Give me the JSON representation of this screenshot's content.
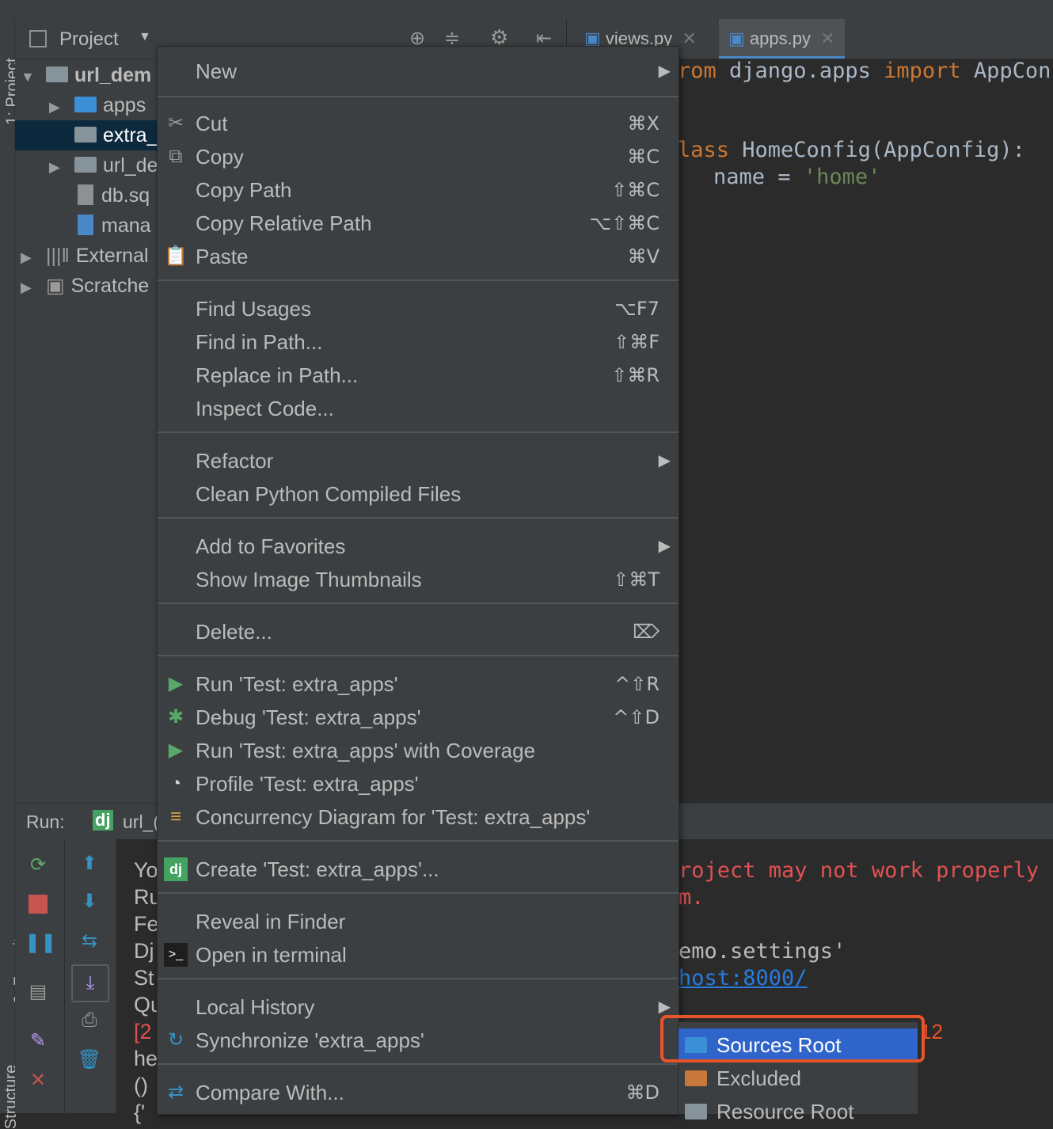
{
  "project_panel": {
    "title": "Project",
    "tree": [
      {
        "label": "url_dem",
        "bold": true,
        "expanded": true
      },
      {
        "label": "apps"
      },
      {
        "label": "extra_"
      },
      {
        "label": "url_de"
      },
      {
        "label": "db.sq"
      },
      {
        "label": "mana"
      },
      {
        "label": "External"
      },
      {
        "label": "Scratche"
      }
    ]
  },
  "editor": {
    "tabs": [
      {
        "label": "views.py"
      },
      {
        "label": "apps.py",
        "active": true
      }
    ],
    "code": {
      "l1_a": "rom ",
      "l1_b": "django.apps ",
      "l1_c": "import ",
      "l1_d": "AppConfi",
      "l2_a": "lass ",
      "l2_b": "HomeConfig(AppConfig):",
      "l3_a": "    name = ",
      "l3_b": "'home'"
    }
  },
  "run_panel": {
    "label": "Run:",
    "config": "url_(",
    "console_prefixes": [
      "Yo",
      "Ru",
      "Fe",
      "Dj",
      "St",
      "Qu",
      "[2",
      "he",
      "()",
      "{'"
    ],
    "console_right": {
      "line1": "roject may not work properly un",
      "line2": "m.",
      "line3": "emo.settings'",
      "link": "host:8000/"
    }
  },
  "context_menu": {
    "items": [
      {
        "label": "New",
        "shortcut": "",
        "submenu": true
      },
      {
        "label": "Cut",
        "shortcut": "⌘X",
        "icon": "scissors-icon"
      },
      {
        "label": "Copy",
        "shortcut": "⌘C",
        "icon": "copy-icon"
      },
      {
        "label": "Copy Path",
        "shortcut": "⇧⌘C"
      },
      {
        "label": "Copy Relative Path",
        "shortcut": "⌥⇧⌘C"
      },
      {
        "label": "Paste",
        "shortcut": "⌘V",
        "icon": "paste-icon"
      },
      {
        "label": "Find Usages",
        "shortcut": "⌥F7"
      },
      {
        "label": "Find in Path...",
        "shortcut": "⇧⌘F"
      },
      {
        "label": "Replace in Path...",
        "shortcut": "⇧⌘R"
      },
      {
        "label": "Inspect Code...",
        "shortcut": ""
      },
      {
        "label": "Refactor",
        "shortcut": "",
        "submenu": true
      },
      {
        "label": "Clean Python Compiled Files",
        "shortcut": ""
      },
      {
        "label": "Add to Favorites",
        "shortcut": "",
        "submenu": true
      },
      {
        "label": "Show Image Thumbnails",
        "shortcut": "⇧⌘T"
      },
      {
        "label": "Delete...",
        "shortcut": "⌦"
      },
      {
        "label": "Run 'Test: extra_apps'",
        "shortcut": "^⇧R",
        "icon": "run-icon"
      },
      {
        "label": "Debug 'Test: extra_apps'",
        "shortcut": "^⇧D",
        "icon": "debug-icon"
      },
      {
        "label": "Run 'Test: extra_apps' with Coverage",
        "shortcut": "",
        "icon": "coverage-icon"
      },
      {
        "label": "Profile 'Test: extra_apps'",
        "shortcut": "",
        "icon": "profile-icon"
      },
      {
        "label": "Concurrency Diagram for 'Test: extra_apps'",
        "shortcut": "",
        "icon": "concurrency-icon"
      },
      {
        "label": "Create 'Test: extra_apps'...",
        "shortcut": "",
        "icon": "django-icon"
      },
      {
        "label": "Reveal in Finder",
        "shortcut": ""
      },
      {
        "label": "Open in terminal",
        "shortcut": "",
        "icon": "terminal-icon"
      },
      {
        "label": "Local History",
        "shortcut": "",
        "submenu": true
      },
      {
        "label": "Synchronize 'extra_apps'",
        "shortcut": "",
        "icon": "sync-icon"
      },
      {
        "label": "Compare With...",
        "shortcut": "⌘D",
        "icon": "compare-icon"
      }
    ]
  },
  "mark_directory_submenu": {
    "items": [
      {
        "label": "Sources Root",
        "selected": true
      },
      {
        "label": "Excluded"
      },
      {
        "label": "Resource Root"
      }
    ]
  },
  "annotation": {
    "badge": "12"
  },
  "colors": {
    "menu_bg": "#3c3f41",
    "selection": "#2f65ca",
    "highlight_box": "#e8532a",
    "keyword": "#cc7832",
    "string": "#6a8759"
  }
}
